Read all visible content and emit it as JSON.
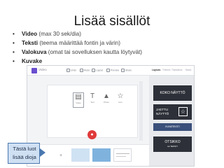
{
  "slide": {
    "title": "Lisää sisällöt",
    "bullets": [
      {
        "bold": "Video",
        "note": " (max 30 sek/dia)"
      },
      {
        "bold": "Teksti",
        "note": " (teema määrittää fontin ja värin)"
      },
      {
        "bold": "Valokuva",
        "note": " (omat tai sovelluksen kautta löytyvät)"
      },
      {
        "bold": "Kuvake",
        "note": ""
      }
    ],
    "bullet_glyph": "•"
  },
  "app": {
    "name": "Video",
    "toolbar": [
      "Undo",
      "Redo",
      "Layout",
      "Preview",
      "Share"
    ],
    "tabs": [
      "Layouts",
      "Themes",
      "Transitions",
      "Music"
    ],
    "active_tab": "Layouts",
    "tiles": [
      {
        "glyph": "▤",
        "label": "Video"
      },
      {
        "glyph": "T",
        "label": "Text"
      },
      {
        "glyph": "▲",
        "label": "Photo"
      },
      {
        "glyph": "☆",
        "label": "Icon"
      }
    ],
    "templates": {
      "full": "KOKO NÄYTTÖ",
      "split": "JAETTU NÄYTTÖ",
      "banner": "KUVATEKSTI",
      "title": "OTSIKKO",
      "title_sub": "tai TEKSTI"
    },
    "add_glyph": "+",
    "mic_glyph": "●",
    "accent": "#6a4fcf",
    "record_color": "#e03a3a"
  },
  "callout": {
    "line1": "Tästä luot",
    "line2": "lisää dioja"
  }
}
